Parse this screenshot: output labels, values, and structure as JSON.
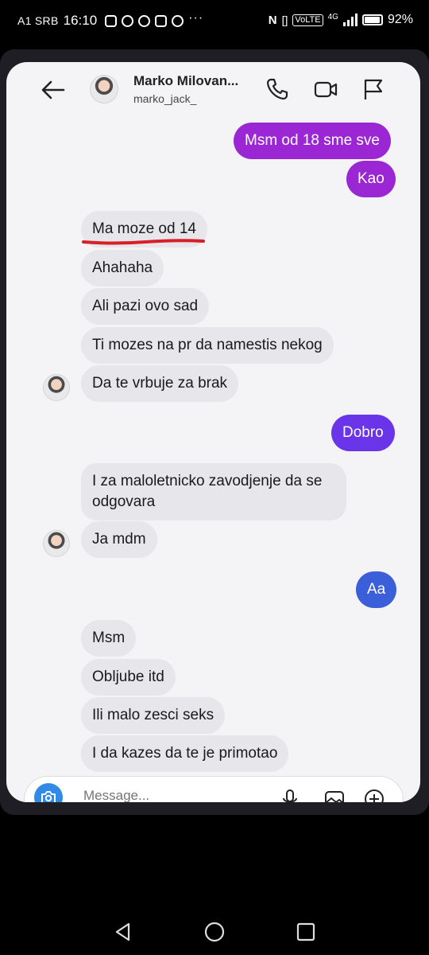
{
  "status_bar": {
    "carrier": "A1 SRB",
    "time": "16:10",
    "volte": "VoLTE",
    "network": "4G",
    "battery": "92%"
  },
  "header": {
    "name": "Marko Milovan...",
    "username": "marko_jack_"
  },
  "messages": [
    {
      "text": "Msm od 18 sme sve",
      "side": "out",
      "color": "#9b27d4"
    },
    {
      "text": "Kao",
      "side": "out",
      "color": "#9b27d4"
    },
    {
      "text": "Ma moze od 14",
      "side": "in",
      "underlined": true
    },
    {
      "text": "Ahahaha",
      "side": "in"
    },
    {
      "text": "Ali pazi ovo sad",
      "side": "in"
    },
    {
      "text": "Ti mozes na pr da namestis nekog",
      "side": "in"
    },
    {
      "text": "Da te vrbuje za brak",
      "side": "in"
    },
    {
      "text": "Dobro",
      "side": "out",
      "color": "#6a35e8"
    },
    {
      "text": "I za maloletnicko zavodjenje da se odgovara",
      "side": "in"
    },
    {
      "text": "Ja mdm",
      "side": "in"
    },
    {
      "text": "Aa",
      "side": "out",
      "color": "#3b5fd8"
    },
    {
      "text": "Msm",
      "side": "in"
    },
    {
      "text": "Obljube itd",
      "side": "in"
    },
    {
      "text": "Ili malo zesci seks",
      "side": "in"
    },
    {
      "text": "I da kazes da te je primotao",
      "side": "in"
    }
  ],
  "composer": {
    "placeholder": "Message..."
  },
  "colors": {
    "incoming_bubble": "#e6e6eb",
    "outgoing_purple": "#9b27d4",
    "outgoing_violet": "#6a35e8",
    "outgoing_blue": "#3b5fd8",
    "underline_red": "#d8202a",
    "camera_blue": "#2f8ae8"
  },
  "icons": {
    "back": "arrow-left-icon",
    "call": "phone-icon",
    "video": "video-camera-icon",
    "flag": "flag-icon",
    "camera": "camera-icon",
    "mic": "microphone-icon",
    "gallery": "image-icon",
    "add": "plus-circle-icon",
    "nav_back": "triangle-back-icon",
    "nav_home": "circle-home-icon",
    "nav_recents": "square-recents-icon"
  }
}
